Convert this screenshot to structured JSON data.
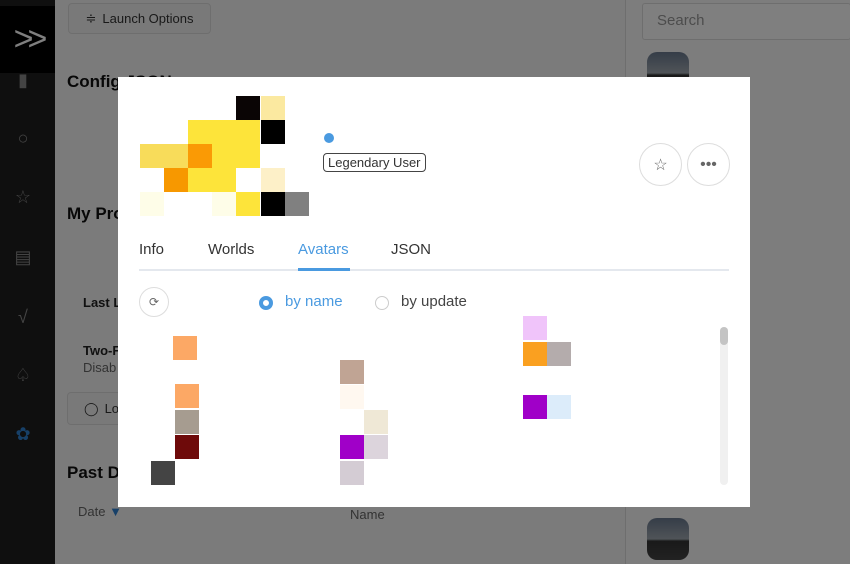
{
  "sidebar": {
    "logo": "»",
    "icons": [
      "bar-chart-icon",
      "search-icon",
      "star-icon",
      "book-icon",
      "checklist-icon",
      "bell-icon",
      "gear-icon"
    ],
    "active_color": "#2f80d0"
  },
  "main": {
    "launch_options": "Launch Options",
    "config_heading": "Config JSON",
    "profile_heading": "My Pro",
    "last_login": "Last L",
    "two_factor": "Two-F",
    "two_factor_status": "Disab",
    "logout_button": "Lo",
    "past_heading": "Past Di",
    "col_date": "Date",
    "col_name": "Name"
  },
  "right": {
    "search_placeholder": "Search"
  },
  "modal": {
    "user_tag": "Legendary User",
    "status_color": "#4a9ae0",
    "tabs": [
      {
        "label": "Info"
      },
      {
        "label": "Worlds"
      },
      {
        "label": "Avatars",
        "active": true
      },
      {
        "label": "JSON"
      }
    ],
    "sort": {
      "by_name": "by name",
      "by_update": "by update",
      "selected": "by name"
    },
    "accent": "#4a9ae0"
  }
}
